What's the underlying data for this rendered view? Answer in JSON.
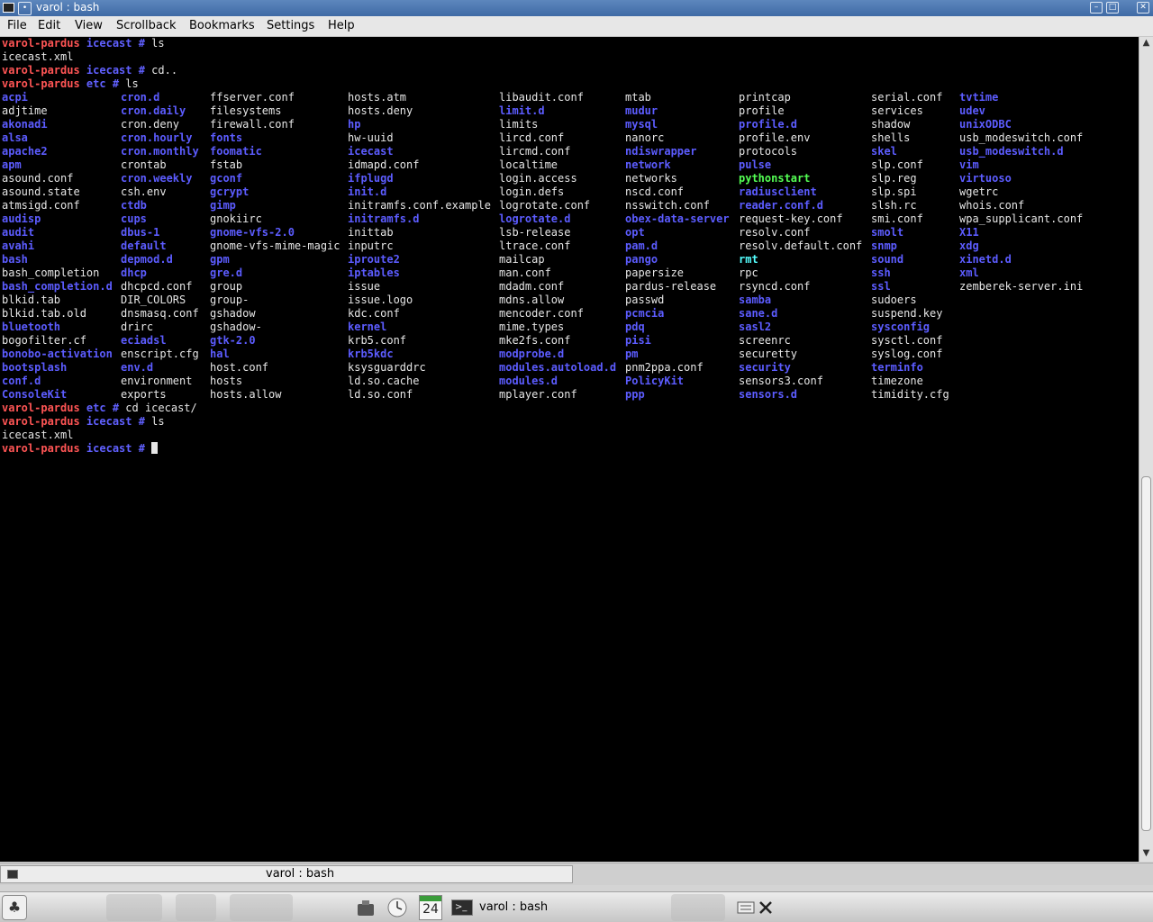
{
  "window": {
    "title": "varol : bash"
  },
  "menu": [
    "File",
    "Edit",
    "View",
    "Scrollback",
    "Bookmarks",
    "Settings",
    "Help"
  ],
  "prompt": {
    "host": "varol-pardus",
    "symbol": "#"
  },
  "lines": [
    {
      "dir": "icecast",
      "cmd": "ls"
    },
    {
      "output": "icecast.xml"
    },
    {
      "dir": "icecast",
      "cmd": "cd.."
    },
    {
      "dir": "etc",
      "cmd": "ls"
    }
  ],
  "after": [
    {
      "dir": "etc",
      "cmd": "cd icecast/"
    },
    {
      "dir": "icecast",
      "cmd": "ls"
    },
    {
      "output": "icecast.xml"
    },
    {
      "dir": "icecast",
      "cmd": "",
      "cursor": true
    }
  ],
  "columns": [
    [
      [
        "acpi",
        "dir"
      ],
      [
        "adjtime",
        "file"
      ],
      [
        "akonadi",
        "dir"
      ],
      [
        "alsa",
        "dir"
      ],
      [
        "apache2",
        "dir"
      ],
      [
        "apm",
        "dir"
      ],
      [
        "asound.conf",
        "file"
      ],
      [
        "asound.state",
        "file"
      ],
      [
        "atmsigd.conf",
        "file"
      ],
      [
        "audisp",
        "dir"
      ],
      [
        "audit",
        "dir"
      ],
      [
        "avahi",
        "dir"
      ],
      [
        "bash",
        "dir"
      ],
      [
        "bash_completion",
        "file"
      ],
      [
        "bash_completion.d",
        "dir"
      ],
      [
        "blkid.tab",
        "file"
      ],
      [
        "blkid.tab.old",
        "file"
      ],
      [
        "bluetooth",
        "dir"
      ],
      [
        "bogofilter.cf",
        "file"
      ],
      [
        "bonobo-activation",
        "dir"
      ],
      [
        "bootsplash",
        "dir"
      ],
      [
        "conf.d",
        "dir"
      ],
      [
        "ConsoleKit",
        "dir"
      ]
    ],
    [
      [
        "cron.d",
        "dir"
      ],
      [
        "cron.daily",
        "dir"
      ],
      [
        "cron.deny",
        "file"
      ],
      [
        "cron.hourly",
        "dir"
      ],
      [
        "cron.monthly",
        "dir"
      ],
      [
        "crontab",
        "file"
      ],
      [
        "cron.weekly",
        "dir"
      ],
      [
        "csh.env",
        "file"
      ],
      [
        "ctdb",
        "dir"
      ],
      [
        "cups",
        "dir"
      ],
      [
        "dbus-1",
        "dir"
      ],
      [
        "default",
        "dir"
      ],
      [
        "depmod.d",
        "dir"
      ],
      [
        "dhcp",
        "dir"
      ],
      [
        "dhcpcd.conf",
        "file"
      ],
      [
        "DIR_COLORS",
        "file"
      ],
      [
        "dnsmasq.conf",
        "file"
      ],
      [
        "drirc",
        "file"
      ],
      [
        "eciadsl",
        "dir"
      ],
      [
        "enscript.cfg",
        "file"
      ],
      [
        "env.d",
        "dir"
      ],
      [
        "environment",
        "file"
      ],
      [
        "exports",
        "file"
      ]
    ],
    [
      [
        "ffserver.conf",
        "file"
      ],
      [
        "filesystems",
        "file"
      ],
      [
        "firewall.conf",
        "file"
      ],
      [
        "fonts",
        "dir"
      ],
      [
        "foomatic",
        "dir"
      ],
      [
        "fstab",
        "file"
      ],
      [
        "gconf",
        "dir"
      ],
      [
        "gcrypt",
        "dir"
      ],
      [
        "gimp",
        "dir"
      ],
      [
        "gnokiirc",
        "file"
      ],
      [
        "gnome-vfs-2.0",
        "dir"
      ],
      [
        "gnome-vfs-mime-magic",
        "file"
      ],
      [
        "gpm",
        "dir"
      ],
      [
        "gre.d",
        "dir"
      ],
      [
        "group",
        "file"
      ],
      [
        "group-",
        "file"
      ],
      [
        "gshadow",
        "file"
      ],
      [
        "gshadow-",
        "file"
      ],
      [
        "gtk-2.0",
        "dir"
      ],
      [
        "hal",
        "dir"
      ],
      [
        "host.conf",
        "file"
      ],
      [
        "hosts",
        "file"
      ],
      [
        "hosts.allow",
        "file"
      ]
    ],
    [
      [
        "hosts.atm",
        "file"
      ],
      [
        "hosts.deny",
        "file"
      ],
      [
        "hp",
        "dir"
      ],
      [
        "hw-uuid",
        "file"
      ],
      [
        "icecast",
        "dir"
      ],
      [
        "idmapd.conf",
        "file"
      ],
      [
        "ifplugd",
        "dir"
      ],
      [
        "init.d",
        "dir"
      ],
      [
        "initramfs.conf.example",
        "file"
      ],
      [
        "initramfs.d",
        "dir"
      ],
      [
        "inittab",
        "file"
      ],
      [
        "inputrc",
        "file"
      ],
      [
        "iproute2",
        "dir"
      ],
      [
        "iptables",
        "dir"
      ],
      [
        "issue",
        "file"
      ],
      [
        "issue.logo",
        "file"
      ],
      [
        "kdc.conf",
        "file"
      ],
      [
        "kernel",
        "dir"
      ],
      [
        "krb5.conf",
        "file"
      ],
      [
        "krb5kdc",
        "dir"
      ],
      [
        "ksysguarddrc",
        "file"
      ],
      [
        "ld.so.cache",
        "file"
      ],
      [
        "ld.so.conf",
        "file"
      ]
    ],
    [
      [
        "libaudit.conf",
        "file"
      ],
      [
        "limit.d",
        "dir"
      ],
      [
        "limits",
        "file"
      ],
      [
        "lircd.conf",
        "file"
      ],
      [
        "lircmd.conf",
        "file"
      ],
      [
        "localtime",
        "file"
      ],
      [
        "login.access",
        "file"
      ],
      [
        "login.defs",
        "file"
      ],
      [
        "logrotate.conf",
        "file"
      ],
      [
        "logrotate.d",
        "dir"
      ],
      [
        "lsb-release",
        "file"
      ],
      [
        "ltrace.conf",
        "file"
      ],
      [
        "mailcap",
        "file"
      ],
      [
        "man.conf",
        "file"
      ],
      [
        "mdadm.conf",
        "file"
      ],
      [
        "mdns.allow",
        "file"
      ],
      [
        "mencoder.conf",
        "file"
      ],
      [
        "mime.types",
        "file"
      ],
      [
        "mke2fs.conf",
        "file"
      ],
      [
        "modprobe.d",
        "dir"
      ],
      [
        "modules.autoload.d",
        "dir"
      ],
      [
        "modules.d",
        "dir"
      ],
      [
        "mplayer.conf",
        "file"
      ]
    ],
    [
      [
        "mtab",
        "file"
      ],
      [
        "mudur",
        "dir"
      ],
      [
        "mysql",
        "dir"
      ],
      [
        "nanorc",
        "file"
      ],
      [
        "ndiswrapper",
        "dir"
      ],
      [
        "network",
        "dir"
      ],
      [
        "networks",
        "file"
      ],
      [
        "nscd.conf",
        "file"
      ],
      [
        "nsswitch.conf",
        "file"
      ],
      [
        "obex-data-server",
        "dir"
      ],
      [
        "opt",
        "dir"
      ],
      [
        "pam.d",
        "dir"
      ],
      [
        "pango",
        "dir"
      ],
      [
        "papersize",
        "file"
      ],
      [
        "pardus-release",
        "file"
      ],
      [
        "passwd",
        "file"
      ],
      [
        "pcmcia",
        "dir"
      ],
      [
        "pdq",
        "dir"
      ],
      [
        "pisi",
        "dir"
      ],
      [
        "pm",
        "dir"
      ],
      [
        "pnm2ppa.conf",
        "file"
      ],
      [
        "PolicyKit",
        "dir"
      ],
      [
        "ppp",
        "dir"
      ]
    ],
    [
      [
        "printcap",
        "file"
      ],
      [
        "profile",
        "file"
      ],
      [
        "profile.d",
        "dir"
      ],
      [
        "profile.env",
        "file"
      ],
      [
        "protocols",
        "file"
      ],
      [
        "pulse",
        "dir"
      ],
      [
        "pythonstart",
        "exec"
      ],
      [
        "radiusclient",
        "dir"
      ],
      [
        "reader.conf.d",
        "dir"
      ],
      [
        "request-key.conf",
        "file"
      ],
      [
        "resolv.conf",
        "file"
      ],
      [
        "resolv.default.conf",
        "file"
      ],
      [
        "rmt",
        "link"
      ],
      [
        "rpc",
        "file"
      ],
      [
        "rsyncd.conf",
        "file"
      ],
      [
        "samba",
        "dir"
      ],
      [
        "sane.d",
        "dir"
      ],
      [
        "sasl2",
        "dir"
      ],
      [
        "screenrc",
        "file"
      ],
      [
        "securetty",
        "file"
      ],
      [
        "security",
        "dir"
      ],
      [
        "sensors3.conf",
        "file"
      ],
      [
        "sensors.d",
        "dir"
      ]
    ],
    [
      [
        "serial.conf",
        "file"
      ],
      [
        "services",
        "file"
      ],
      [
        "shadow",
        "file"
      ],
      [
        "shells",
        "file"
      ],
      [
        "skel",
        "dir"
      ],
      [
        "slp.conf",
        "file"
      ],
      [
        "slp.reg",
        "file"
      ],
      [
        "slp.spi",
        "file"
      ],
      [
        "slsh.rc",
        "file"
      ],
      [
        "smi.conf",
        "file"
      ],
      [
        "smolt",
        "dir"
      ],
      [
        "snmp",
        "dir"
      ],
      [
        "sound",
        "dir"
      ],
      [
        "ssh",
        "dir"
      ],
      [
        "ssl",
        "dir"
      ],
      [
        "sudoers",
        "file"
      ],
      [
        "suspend.key",
        "file"
      ],
      [
        "sysconfig",
        "dir"
      ],
      [
        "sysctl.conf",
        "file"
      ],
      [
        "syslog.conf",
        "file"
      ],
      [
        "terminfo",
        "dir"
      ],
      [
        "timezone",
        "file"
      ],
      [
        "timidity.cfg",
        "file"
      ]
    ],
    [
      [
        "tvtime",
        "dir"
      ],
      [
        "udev",
        "dir"
      ],
      [
        "unixODBC",
        "dir"
      ],
      [
        "usb_modeswitch.conf",
        "file"
      ],
      [
        "usb_modeswitch.d",
        "dir"
      ],
      [
        "vim",
        "dir"
      ],
      [
        "virtuoso",
        "dir"
      ],
      [
        "wgetrc",
        "file"
      ],
      [
        "whois.conf",
        "file"
      ],
      [
        "wpa_supplicant.conf",
        "file"
      ],
      [
        "X11",
        "dir"
      ],
      [
        "xdg",
        "dir"
      ],
      [
        "xinetd.d",
        "dir"
      ],
      [
        "xml",
        "dir"
      ],
      [
        "zemberek-server.ini",
        "file"
      ]
    ]
  ],
  "tabs": {
    "session": "varol : bash"
  },
  "taskbar": {
    "calendar_day": "24",
    "task": "varol : bash"
  }
}
